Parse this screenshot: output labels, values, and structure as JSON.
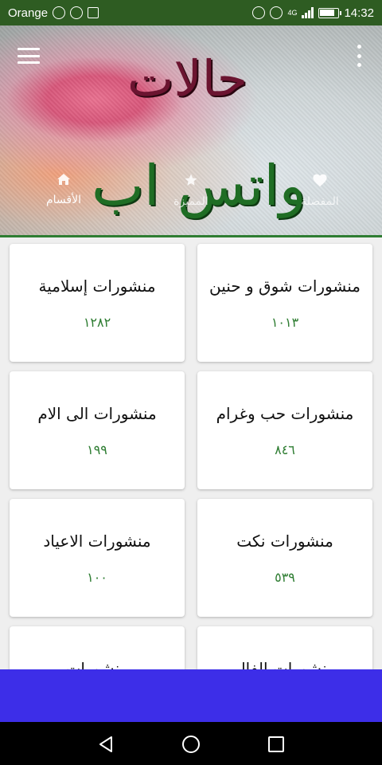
{
  "status_bar": {
    "carrier": "Orange",
    "network": "4G",
    "time": "14:32"
  },
  "header": {
    "title_top": "حالات",
    "title_bottom": "واتس اب",
    "tabs": [
      {
        "label": "الأقسام",
        "icon": "home-icon",
        "active": true
      },
      {
        "label": "المميزة",
        "icon": "star-icon",
        "active": false
      },
      {
        "label": "المفضلة",
        "icon": "heart-icon",
        "active": false
      }
    ]
  },
  "cards": [
    {
      "title": "منشورات شوق و حنين",
      "count": "١٠١٣"
    },
    {
      "title": "منشورات إسلامية",
      "count": "١٢٨٢"
    },
    {
      "title": "منشورات حب وغرام",
      "count": "٨٤٦"
    },
    {
      "title": "منشورات الى الام",
      "count": "١٩٩"
    },
    {
      "title": "منشورات نكت",
      "count": "٥٣٩"
    },
    {
      "title": "منشورات الاعياد",
      "count": "١٠٠"
    },
    {
      "title": "منشورات الفال",
      "count": ""
    },
    {
      "title": "منشورات",
      "count": ""
    }
  ],
  "colors": {
    "status_bar": "#2e5c22",
    "accent_green": "#2e7d32",
    "ad_bar": "#3d2ee8"
  }
}
